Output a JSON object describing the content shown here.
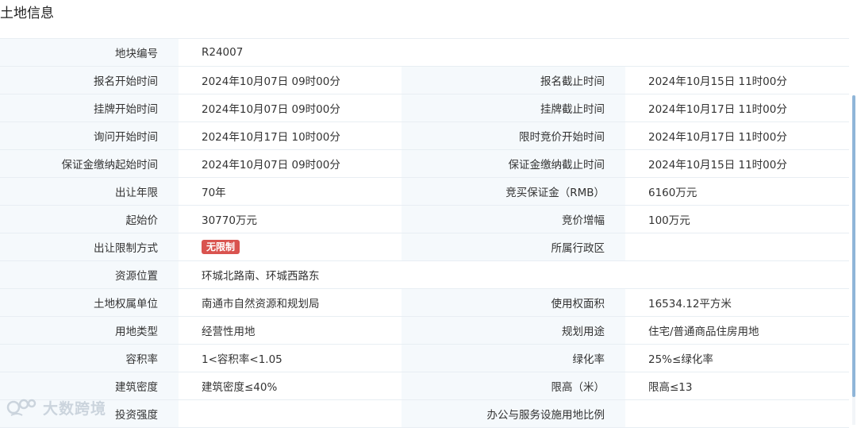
{
  "page": {
    "title": "土地信息"
  },
  "rows": [
    {
      "l1": "地块编号",
      "v1": "R24007",
      "l2": "",
      "v2": ""
    },
    {
      "l1": "报名开始时间",
      "v1": "2024年10月07日 09时00分",
      "l2": "报名截止时间",
      "v2": "2024年10月15日 11时00分"
    },
    {
      "l1": "挂牌开始时间",
      "v1": "2024年10月07日 09时00分",
      "l2": "挂牌截止时间",
      "v2": "2024年10月17日 11时00分"
    },
    {
      "l1": "询问开始时间",
      "v1": "2024年10月17日 10时00分",
      "l2": "限时竞价开始时间",
      "v2": "2024年10月17日 11时00分"
    },
    {
      "l1": "保证金缴纳起始时间",
      "v1": "2024年10月07日 09时00分",
      "l2": "保证金缴纳截止时间",
      "v2": "2024年10月15日 11时00分"
    },
    {
      "l1": "出让年限",
      "v1": "70年",
      "l2": "竞买保证金（RMB）",
      "v2": "6160万元"
    },
    {
      "l1": "起始价",
      "v1": "30770万元",
      "l2": "竞价增幅",
      "v2": "100万元"
    },
    {
      "l1": "出让限制方式",
      "v1": "无限制",
      "l2": "所属行政区",
      "v2": ""
    },
    {
      "l1": "资源位置",
      "v1": "环城北路南、环城西路东",
      "l2": "",
      "v2": ""
    },
    {
      "l1": "土地权属单位",
      "v1": "南通市自然资源和规划局",
      "l2": "使用权面积",
      "v2": "16534.12平方米"
    },
    {
      "l1": "用地类型",
      "v1": "经营性用地",
      "l2": "规划用途",
      "v2": "住宅/普通商品住房用地"
    },
    {
      "l1": "容积率",
      "v1": "1<容积率<1.05",
      "l2": "绿化率",
      "v2": "25%≤绿化率"
    },
    {
      "l1": "建筑密度",
      "v1": "建筑密度≤40%",
      "l2": "限高（米）",
      "v2": "限高≤13"
    },
    {
      "l1": "投资强度",
      "v1": "",
      "l2": "办公与服务设施用地比例",
      "v2": ""
    }
  ],
  "badge_color": "#d9534f",
  "label_bg": "#f5f9fc",
  "watermark": {
    "text": "大数跨境",
    "icon": "dashuju-logo-icon"
  }
}
